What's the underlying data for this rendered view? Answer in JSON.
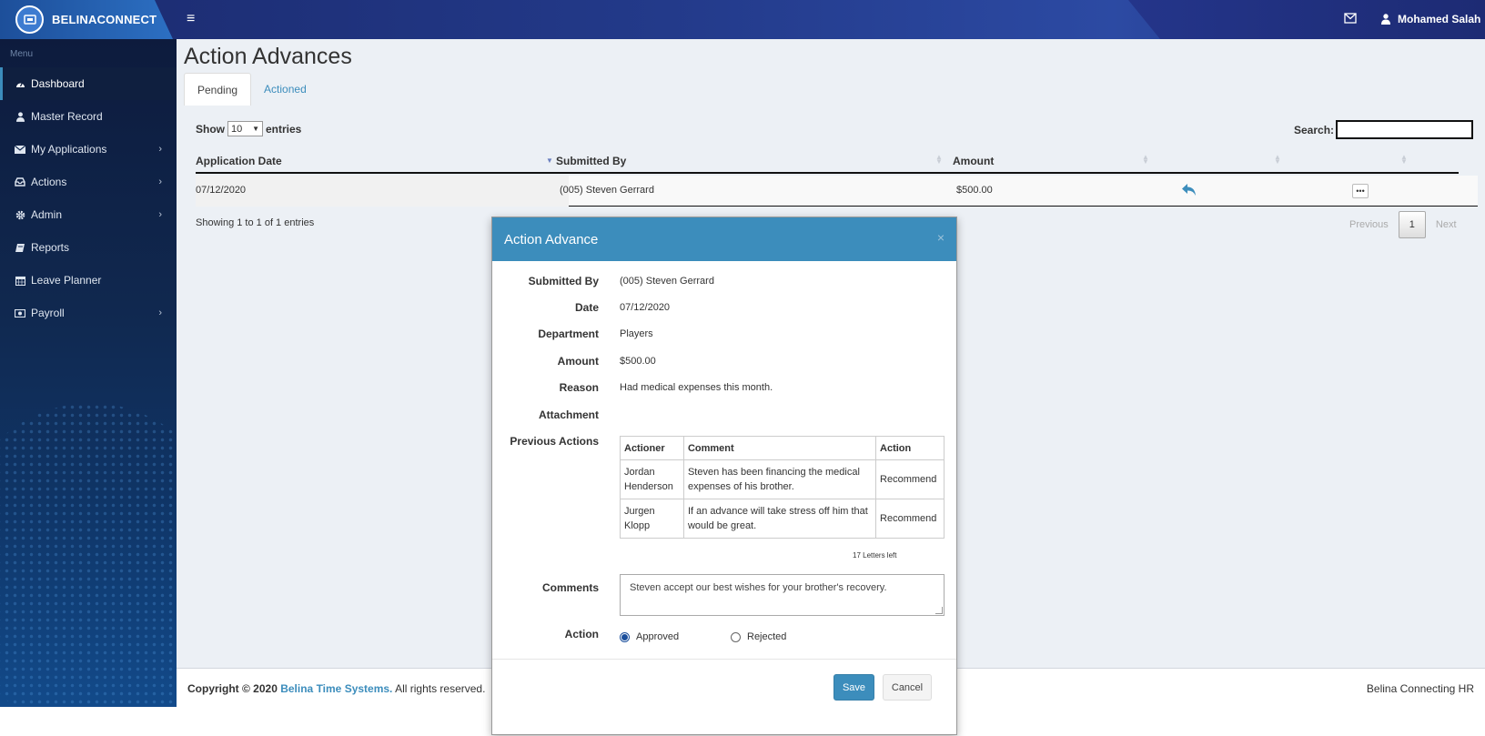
{
  "app": {
    "logo_text": "BELINACONNECT",
    "user_name": "Mohamed Salah"
  },
  "sidebar": {
    "menu_label": "Menu",
    "items": [
      {
        "label": "Dashboard",
        "icon": "dashboard-icon"
      },
      {
        "label": "Master Record",
        "icon": "user-icon"
      },
      {
        "label": "My Applications",
        "icon": "envelope-icon"
      },
      {
        "label": "Actions",
        "icon": "inbox-icon"
      },
      {
        "label": "Admin",
        "icon": "gear-icon"
      },
      {
        "label": "Reports",
        "icon": "book-icon"
      },
      {
        "label": "Leave Planner",
        "icon": "calendar-icon"
      },
      {
        "label": "Payroll",
        "icon": "money-icon"
      }
    ]
  },
  "page": {
    "title": "Action Advances",
    "tabs": [
      "Pending",
      "Actioned"
    ]
  },
  "table": {
    "show_label": "Show",
    "entries_value": "10",
    "entries_label": "entries",
    "search_label": "Search:",
    "columns": [
      "Application Date",
      "Submitted By",
      "Amount"
    ],
    "rows": [
      {
        "date": "07/12/2020",
        "submitted_by": "(005) Steven Gerrard",
        "amount": "$500.00"
      }
    ],
    "showing_text": "Showing 1 to 1 of 1 entries",
    "pager": {
      "previous": "Previous",
      "current": "1",
      "next": "Next"
    }
  },
  "footer": {
    "copyright": "Copyright © 2020",
    "brand": "Belina Time Systems.",
    "rights": "All rights reserved.",
    "tagline": "Belina Connecting HR"
  },
  "modal": {
    "title": "Action Advance",
    "close": "×",
    "fields": {
      "submitted_by_label": "Submitted By",
      "submitted_by": "(005) Steven Gerrard",
      "date_label": "Date",
      "date": "07/12/2020",
      "department_label": "Department",
      "department": "Players",
      "amount_label": "Amount",
      "amount": "$500.00",
      "reason_label": "Reason",
      "reason": "Had medical expenses this month.",
      "attachment_label": "Attachment",
      "previous_actions_label": "Previous Actions"
    },
    "previous_actions": {
      "headers": [
        "Actioner",
        "Comment",
        "Action"
      ],
      "rows": [
        {
          "actioner": "Jordan Henderson",
          "comment": "Steven has been financing the medical expenses of his brother.",
          "action": "Recommend"
        },
        {
          "actioner": "Jurgen Klopp",
          "comment": "If an advance will take stress off him that would be great.",
          "action": "Recommend"
        }
      ]
    },
    "letters_left": "17 Letters left",
    "comments_label": "Comments",
    "comments_value": "Steven accept our best wishes for your brother's recovery.",
    "action_label": "Action",
    "options": [
      "Approved",
      "Rejected"
    ],
    "selected": "Approved",
    "save": "Save",
    "cancel": "Cancel"
  }
}
